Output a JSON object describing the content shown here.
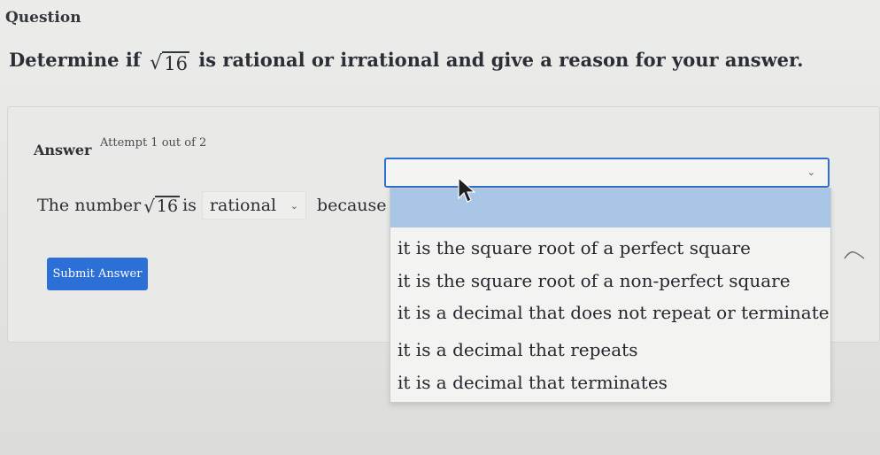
{
  "question": {
    "section_label": "Question",
    "prompt_prefix": "Determine if",
    "radicand": "16",
    "prompt_suffix": "is rational or irrational and give a reason for your answer."
  },
  "answer": {
    "label": "Answer",
    "attempt": "Attempt 1 out of 2",
    "sentence_start": "The number",
    "radicand": "16",
    "sentence_is": "is",
    "first_select_value": "rational",
    "because_label": "because",
    "second_select_value": "",
    "options": [
      "it is the square root of a perfect square",
      "it is the square root of a non-perfect square",
      "it is a decimal that does not repeat or terminate",
      "it is a decimal that repeats",
      "it is a decimal that terminates"
    ]
  },
  "submit_button": {
    "label": "Submit Answer"
  },
  "colors": {
    "accent_blue": "#2c6fd6",
    "dropdown_highlight": "#a9c6e6"
  },
  "icons": {
    "dropdown": "chevron-down-icon",
    "cursor": "mouse-pointer-icon"
  }
}
